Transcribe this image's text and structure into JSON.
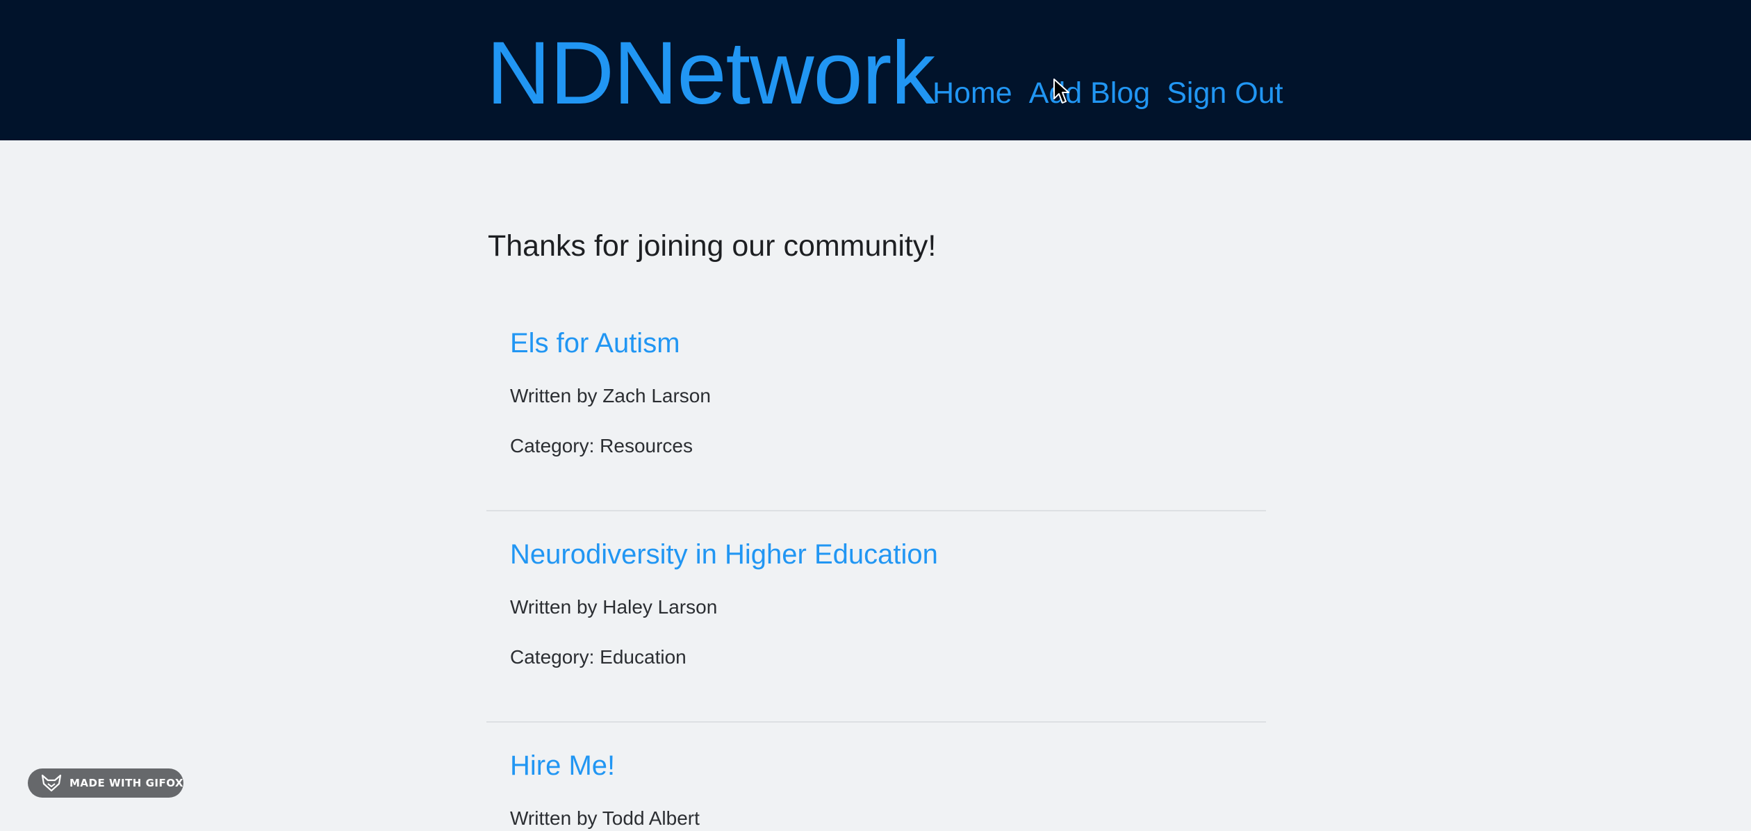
{
  "header": {
    "brand": "NDNetwork",
    "nav": [
      {
        "label": "Home"
      },
      {
        "label": "Add Blog"
      },
      {
        "label": "Sign Out"
      }
    ]
  },
  "main": {
    "welcome": "Thanks for joining our community!",
    "posts": [
      {
        "title": "Els for Autism",
        "author": "Written by Zach Larson",
        "category": "Category: Resources"
      },
      {
        "title": "Neurodiversity in Higher Education",
        "author": "Written by Haley Larson",
        "category": "Category: Education"
      },
      {
        "title": "Hire Me!",
        "author": "Written by Todd Albert",
        "category": ""
      }
    ]
  },
  "badge": {
    "label": "MADE WITH GIFOX",
    "icon": "fox-icon"
  },
  "cursor": {
    "icon": "mouse-pointer-icon"
  },
  "colors": {
    "header_bg": "#01132b",
    "accent": "#2196f3",
    "page_bg": "#f0f2f4"
  }
}
